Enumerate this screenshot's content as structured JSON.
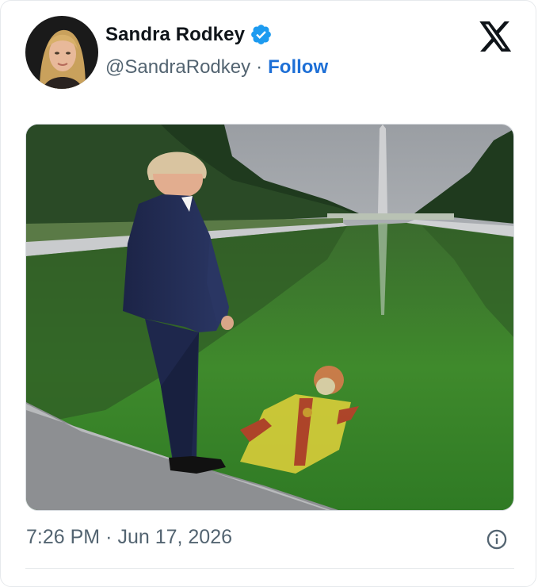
{
  "tweet": {
    "author_name": "Sandra Rodkey",
    "handle": "@SandraRodkey",
    "separator": "·",
    "follow_label": "Follow",
    "time": "7:26 PM",
    "date": "Jun 17, 2026"
  },
  "icons": {
    "verified": "verified-badge-icon",
    "platform": "x-logo-icon",
    "info": "info-icon"
  },
  "colors": {
    "accent": "#1d6fd6",
    "verified": "#1d9bf0",
    "muted": "#536471",
    "text": "#0f1419"
  }
}
